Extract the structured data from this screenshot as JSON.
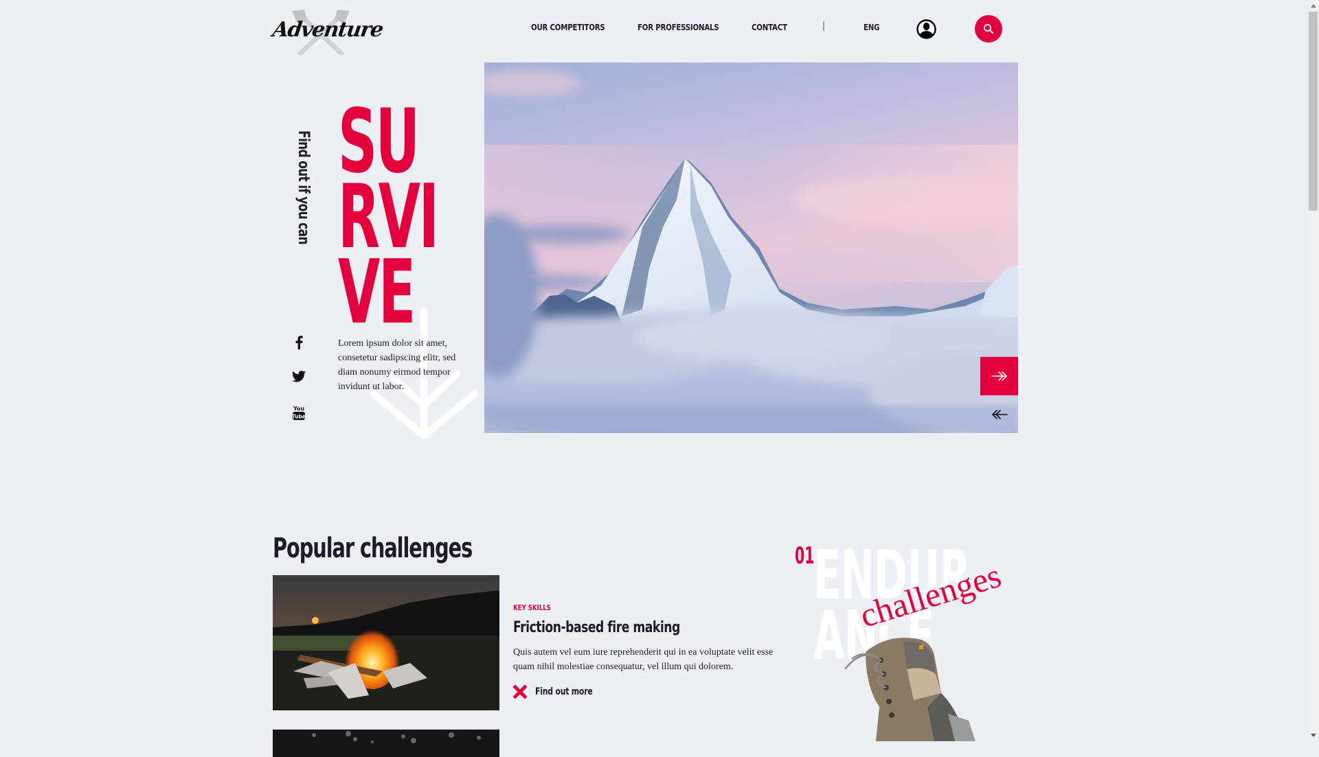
{
  "brand": {
    "logo_text": "Adventure",
    "accent_color": "#e4003d"
  },
  "nav": {
    "items": [
      {
        "label": "OUR COMPETITORS"
      },
      {
        "label": "FOR PROFESSIONALS"
      },
      {
        "label": "CONTACT"
      }
    ],
    "language": "ENG",
    "user_icon": "user-circle-icon",
    "search_icon": "search-icon"
  },
  "hero": {
    "tagline": "Find out if you can",
    "title_lines": [
      "SU",
      "RVI",
      "VE"
    ],
    "description": "Lorem ipsum dolor sit amet, consetetur sadipscing elitr, sed diam nonumy eirmod tempor invidunt ut labor.",
    "social": [
      {
        "name": "facebook",
        "icon": "facebook-icon"
      },
      {
        "name": "twitter",
        "icon": "twitter-icon"
      },
      {
        "name": "youtube",
        "icon": "youtube-icon",
        "text_top": "You",
        "text_bottom": "Tube"
      }
    ],
    "image_alt": "Snow-capped mountain peak above clouds at dusk",
    "next_icon": "arrow-right-icon",
    "prev_icon": "arrow-left-icon"
  },
  "popular": {
    "heading": "Popular challenges",
    "cards": [
      {
        "tag": "KEY SKILLS",
        "title": "Friction-based fire making",
        "description": "Quis autem vel eum iure reprehenderit qui in ea voluptate velit esse quam nihil molestiae consequatur, vel illum qui dolorem.",
        "link_label": "Find out more",
        "image_alt": "Campfire at sunset"
      },
      {
        "image_alt": "Dark forest"
      }
    ]
  },
  "feature": {
    "number": "01",
    "word_lines": [
      "ENDUR",
      "ANCE"
    ],
    "script": "challenges",
    "image_alt": "Hiking boot"
  }
}
